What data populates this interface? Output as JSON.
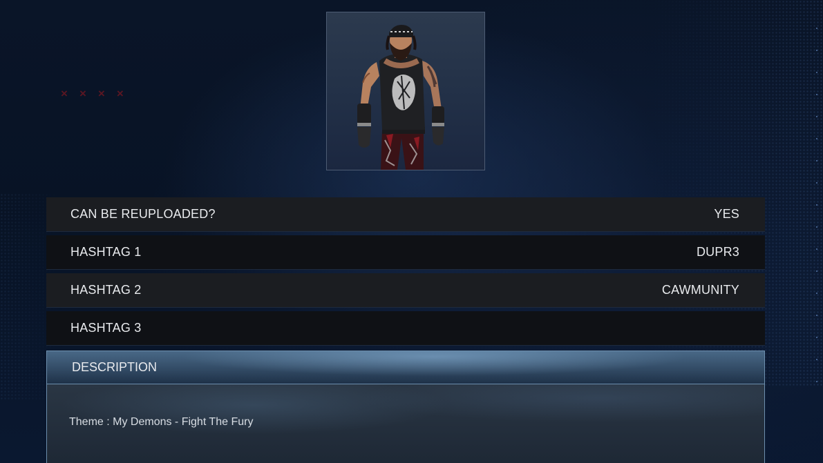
{
  "decor": {
    "x_marks": [
      "×",
      "×",
      "×",
      "×"
    ],
    "x_mark_color": "#5a1622"
  },
  "portrait": {
    "icon": "wrestler-render-image"
  },
  "rows": [
    {
      "label": "CAN BE REUPLOADED?",
      "value": "YES"
    },
    {
      "label": "HASHTAG 1",
      "value": "DUPR3"
    },
    {
      "label": "HASHTAG 2",
      "value": "CAWMUNITY"
    },
    {
      "label": "HASHTAG 3",
      "value": ""
    }
  ],
  "description": {
    "header": "DESCRIPTION",
    "text": "Theme : My Demons - Fight The Fury"
  },
  "colors": {
    "background": "#06101f",
    "row_light": "#1b1d21",
    "row_dark": "#0f1115",
    "text": "#e9ebee",
    "description_border": "#6d8fae"
  }
}
